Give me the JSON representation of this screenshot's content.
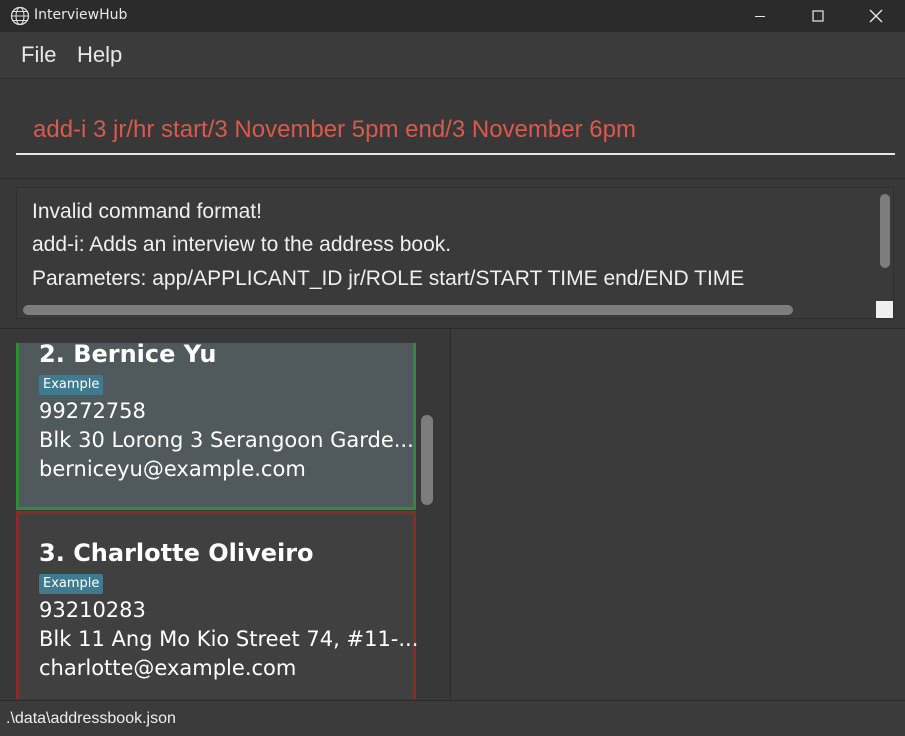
{
  "window": {
    "title": "InterviewHub",
    "icon": "globe-icon"
  },
  "menu": {
    "items": [
      "File",
      "Help"
    ]
  },
  "command": {
    "value": "add-i 3 jr/hr start/3 November 5pm end/3 November 6pm",
    "color": "#d9594c"
  },
  "result": {
    "lines": [
      "Invalid command format!",
      "add-i: Adds an interview to the address book.",
      "Parameters: app/APPLICANT_ID jr/ROLE start/START TIME end/END TIME"
    ]
  },
  "applicants": [
    {
      "index": "2.",
      "name": "Bernice Yu",
      "tag": "Example",
      "phone": "99272758",
      "address": "Blk 30 Lorong 3 Serangoon Garde...",
      "email": "berniceyu@example.com",
      "accent": "#2f8a3a"
    },
    {
      "index": "3.",
      "name": "Charlotte Oliveiro",
      "tag": "Example",
      "phone": "93210283",
      "address": "Blk 11 Ang Mo Kio Street 74, #11-...",
      "email": "charlotte@example.com",
      "accent": "#8a2b2b"
    }
  ],
  "status": {
    "path": ".\\data\\addressbook.json"
  }
}
